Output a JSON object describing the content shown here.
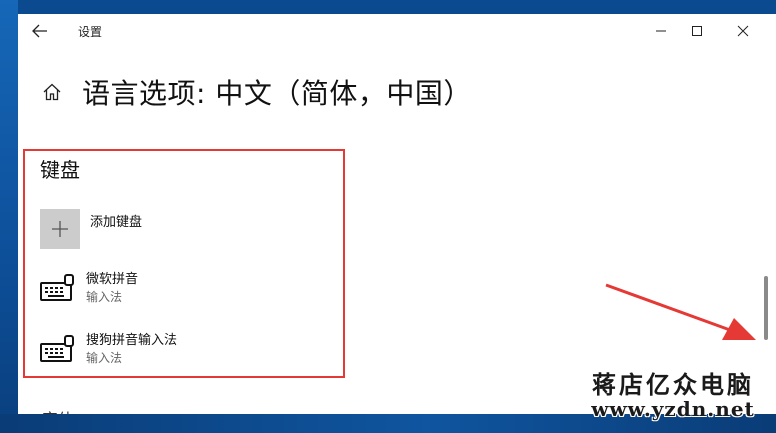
{
  "window": {
    "app_title": "设置",
    "controls": [
      "minimize",
      "maximize",
      "close"
    ]
  },
  "header": {
    "title": "语言选项: 中文（简体，中国）",
    "icon": "home-icon"
  },
  "keyboard_section": {
    "title": "键盘",
    "add_label": "添加键盘",
    "items": [
      {
        "name": "微软拼音",
        "sub": "输入法",
        "icon": "keyboard-icon"
      },
      {
        "name": "搜狗拼音输入法",
        "sub": "输入法",
        "icon": "keyboard-icon"
      }
    ]
  },
  "below_fold_text": "字体",
  "watermark": {
    "text": "蒋店亿众电脑",
    "url": "www.yzdn.net"
  },
  "colors": {
    "highlight_border": "#e53935",
    "annotation_arrow": "#e53935",
    "desktop": "#0d4f99",
    "add_tile": "#cccccc"
  }
}
